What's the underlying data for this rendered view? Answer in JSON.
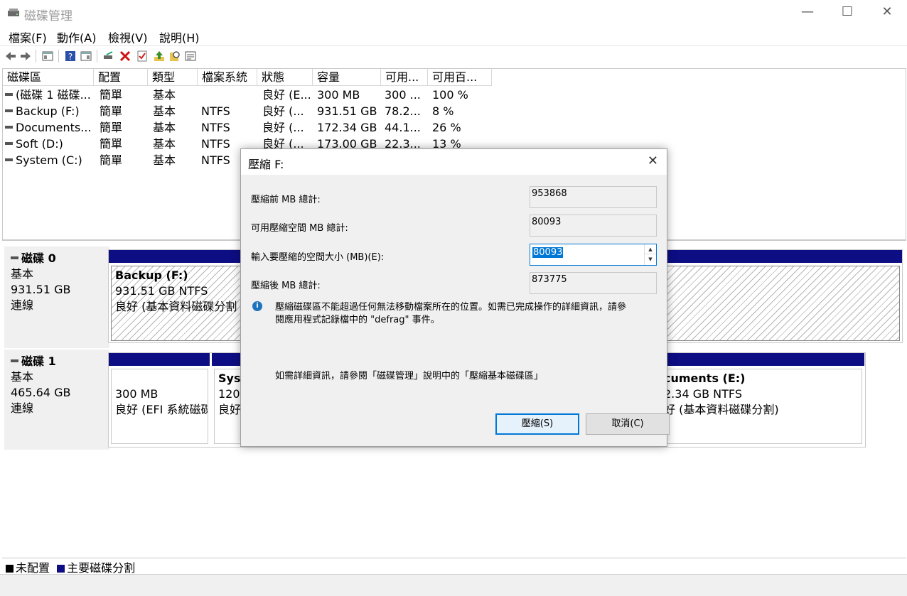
{
  "window": {
    "title": "磁碟管理",
    "minimize": "—",
    "maximize": "☐",
    "close": "✕"
  },
  "menu": [
    "檔案(F)",
    "動作(A)",
    "檢視(V)",
    "說明(H)"
  ],
  "toolbar": [
    "back-arrow-icon",
    "forward-arrow-icon",
    "console-tree-icon",
    "help-icon",
    "properties-icon",
    "connect-icon",
    "delete-icon",
    "check-icon",
    "up-icon",
    "search-icon",
    "list-icon"
  ],
  "columns": [
    "磁碟區",
    "配置",
    "類型",
    "檔案系統",
    "狀態",
    "容量",
    "可用...",
    "可用百..."
  ],
  "volumes": [
    {
      "name": "(磁碟 1 磁碟...",
      "layout": "簡單",
      "type": "基本",
      "fs": "",
      "status": "良好 (E...",
      "capacity": "300 MB",
      "free": "300 ...",
      "pct": "100 %"
    },
    {
      "name": "Backup (F:)",
      "layout": "簡單",
      "type": "基本",
      "fs": "NTFS",
      "status": "良好 (...",
      "capacity": "931.51 GB",
      "free": "78.2...",
      "pct": "8 %"
    },
    {
      "name": "Documents...",
      "layout": "簡單",
      "type": "基本",
      "fs": "NTFS",
      "status": "良好 (...",
      "capacity": "172.34 GB",
      "free": "44.1...",
      "pct": "26 %"
    },
    {
      "name": "Soft (D:)",
      "layout": "簡單",
      "type": "基本",
      "fs": "NTFS",
      "status": "良好 (...",
      "capacity": "173.00 GB",
      "free": "22.3...",
      "pct": "13 %"
    },
    {
      "name": "System (C:)",
      "layout": "簡單",
      "type": "基本",
      "fs": "NTFS",
      "status": "",
      "capacity": "",
      "free": "",
      "pct": ""
    }
  ],
  "disks": [
    {
      "name": "磁碟 0",
      "type": "基本",
      "size": "931.51 GB",
      "state": "連線"
    },
    {
      "name": "磁碟 1",
      "type": "基本",
      "size": "465.64 GB",
      "state": "連線"
    }
  ],
  "partitions": {
    "backup": {
      "title": "Backup  (F:)",
      "size": "931.51 GB NTFS",
      "status": "良好 (基本資料磁碟分割"
    },
    "efi": {
      "size": "300 MB",
      "status": "良好 (EFI 系統磁碟"
    },
    "system": {
      "title": "Syst",
      "size": "120.",
      "status": "良好"
    },
    "documents": {
      "title": "cuments  (E:)",
      "size": "2.34 GB NTFS",
      "status": "好 (基本資料磁碟分割)"
    }
  },
  "legend": {
    "unallocated": "未配置",
    "primary": "主要磁碟分割"
  },
  "dialog": {
    "title": "壓縮 F:",
    "labels": {
      "before": "壓縮前 MB 總計:",
      "available": "可用壓縮空間 MB 總計:",
      "amount": "輸入要壓縮的空間大小 (MB)(E):",
      "after": "壓縮後 MB 總計:"
    },
    "values": {
      "before": "953868",
      "available": "80093",
      "amount": "80093",
      "after": "873775"
    },
    "info_line1": "壓縮磁碟區不能超過任何無法移動檔案所在的位置。如需已完成操作的詳細資訊，請參",
    "info_line2": "閱應用程式記錄檔中的 \"defrag\" 事件。",
    "more_info": "如需詳細資訊，請參閱「磁碟管理」說明中的「壓縮基本磁碟區」",
    "shrink_button": "壓縮(S)",
    "cancel_button": "取消(C)"
  },
  "colors": {
    "primary_partition": "#0d0d84",
    "accent": "#0078d7"
  }
}
